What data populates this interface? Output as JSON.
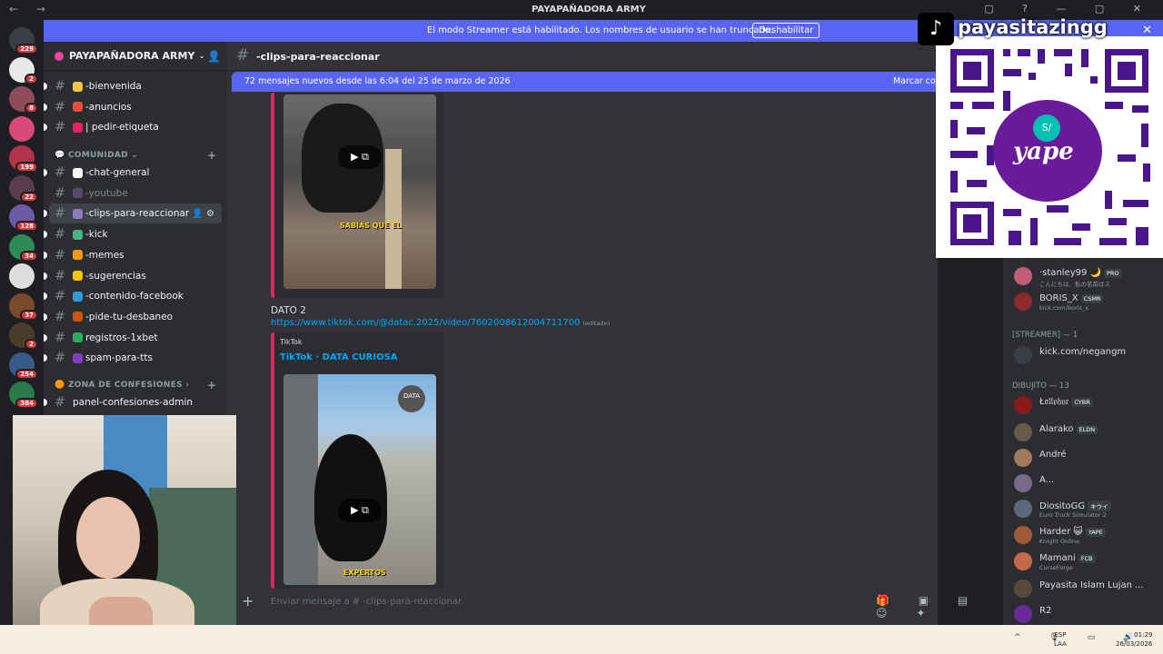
{
  "window": {
    "title": "PAYAPAÑADORA ARMY"
  },
  "streamer_banner": {
    "message": "El modo Streamer está habilitado. Los nombres de usuario se han truncado.",
    "button": "Deshabilitar"
  },
  "servers": [
    {
      "badge": "229",
      "color": "#3b3d44"
    },
    {
      "badge": "2",
      "color": "#e9e9e9"
    },
    {
      "badge": "8",
      "color": "#8e4b5a"
    },
    {
      "badge": "",
      "color": "#d84a7a"
    },
    {
      "badge": "199",
      "color": "#b3344a"
    },
    {
      "badge": "22",
      "color": "#5a3c4a"
    },
    {
      "badge": "128",
      "color": "#6b5aa6"
    },
    {
      "badge": "34",
      "color": "#2e8b57"
    },
    {
      "badge": "",
      "color": "#ddd"
    },
    {
      "badge": "37",
      "color": "#7a4b2a"
    },
    {
      "badge": "2",
      "color": "#4a3b2a"
    },
    {
      "badge": "254",
      "color": "#3a5a8a"
    },
    {
      "badge": "384",
      "color": "#2a7a4a"
    }
  ],
  "guild": {
    "name": "PAYAPAÑADORA ARMY"
  },
  "channels": {
    "top": [
      {
        "name": "-bienvenida",
        "emoji": "#f5c542"
      },
      {
        "name": "-anuncios",
        "emoji": "#e74c3c"
      },
      {
        "name": "| pedir-etiqueta",
        "emoji": "#e91e63"
      }
    ],
    "cat1": "COMUNIDAD",
    "community": [
      {
        "name": "-chat-general",
        "emoji": "#ffffff",
        "muted": false,
        "active": false
      },
      {
        "name": "-youtube",
        "emoji": "#5a4a6a",
        "muted": true,
        "active": false
      },
      {
        "name": "-clips-para-reaccionar",
        "emoji": "#8e7dbe",
        "muted": false,
        "active": true
      },
      {
        "name": "-kick",
        "emoji": "#43b581",
        "muted": false,
        "active": false
      },
      {
        "name": "-memes",
        "emoji": "#f39c12",
        "muted": false,
        "active": false
      },
      {
        "name": "-sugerencias",
        "emoji": "#f1c40f",
        "muted": false,
        "active": false
      },
      {
        "name": "-contenido-facebook",
        "emoji": "#3498db",
        "muted": false,
        "active": false
      },
      {
        "name": "-pide-tu-desbaneo",
        "emoji": "#d35400",
        "muted": false,
        "active": false
      },
      {
        "name": "registros-1xbet",
        "emoji": "#27ae60",
        "muted": false,
        "active": false
      },
      {
        "name": "spam-para-tts",
        "emoji": "#7f3fbf",
        "muted": false,
        "active": false
      }
    ],
    "cat2": "ZONA DE CONFESIONES",
    "confessions": [
      {
        "name": "panel-confesiones-admin"
      }
    ]
  },
  "main": {
    "channel_name": "-clips-para-reaccionar",
    "new_messages": "72 mensajes nuevos desde las 6:04 del 25 de marzo de 2026",
    "mark_read": "Marcar co",
    "embed1_caption": "SABÍAS QUE EL",
    "message2": "DATO 2",
    "link2": "https://www.tiktok.com/@datac.2025/video/7602008612004711700",
    "edited": "(editado)",
    "embed2_provider": "TikTok",
    "embed2_title": "TikTok · DATA CURIOSA",
    "embed2_badge": "DATA",
    "embed2_caption": "EXPERTOS",
    "composer_placeholder": "Enviar mensaje a # -clips-para-reaccionar"
  },
  "members": {
    "items_top": [
      {
        "name": "·stanley99 🌙",
        "tag": "PRO",
        "sub": "こんにちは、私の名前はス",
        "color": "#c45b7a"
      },
      {
        "name": "BORIS_X",
        "tag": "CSMR",
        "sub": "kick.com/boris_x",
        "color": "#8a2a2a"
      }
    ],
    "group_streamer": "[STREAMER] — 1",
    "streamer": {
      "name": "kick.com/negangm",
      "color": "#3b3d44"
    },
    "group_dibujito": "DIBUJITO — 13",
    "items": [
      {
        "name": "Ł𝔞𝔩𝔩𝔭𝔥𝔶𝔯",
        "tag": "CYBR",
        "sub": "",
        "color": "#8a1a1a"
      },
      {
        "name": "Alarako",
        "tag": "ELDN",
        "sub": "",
        "color": "#6a5a4a"
      },
      {
        "name": "André",
        "tag": "",
        "sub": "",
        "color": "#a07a5a"
      },
      {
        "name": "A...",
        "tag": "",
        "sub": "",
        "color": "#7a6a8a"
      },
      {
        "name": "DiositoGG",
        "tag": "キウイ",
        "sub": "Euro Truck Simulator 2",
        "color": "#5a6a7a"
      },
      {
        "name": "Harder 😺",
        "tag": "YAPE",
        "sub": "Knight Online",
        "color": "#a05a3a"
      },
      {
        "name": "Mamani",
        "tag": "FCB",
        "sub": "CurseForge",
        "color": "#c46a4a"
      },
      {
        "name": "Payasita Islam Lujan ...",
        "tag": "",
        "sub": "",
        "color": "#5a4a3a"
      },
      {
        "name": "R2",
        "tag": "",
        "sub": "",
        "color": "#6a2a9a"
      }
    ]
  },
  "overlay": {
    "handle": "payasitazingg",
    "wallet": "yape",
    "wallet_mark": "S/"
  },
  "taskbar": {
    "lang1": "ESP",
    "lang2": "LAA",
    "time": "01:29",
    "date": "26/03/2026"
  }
}
